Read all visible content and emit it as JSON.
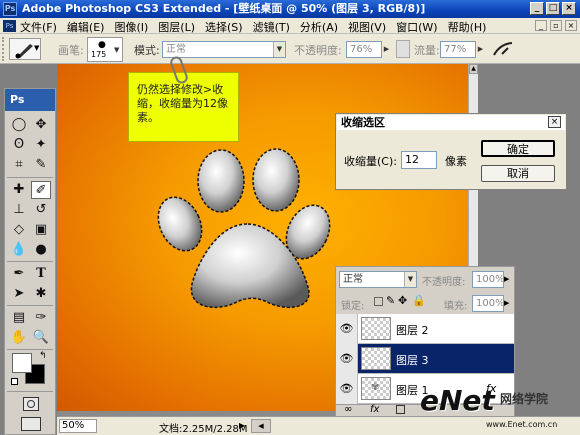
{
  "app": {
    "title": "Adobe Photoshop CS3 Extended - [壁纸桌面 @ 50% (图层 3, RGB/8)]",
    "icon_text": "Ps"
  },
  "menu": [
    "文件(F)",
    "编辑(E)",
    "图像(I)",
    "图层(L)",
    "选择(S)",
    "滤镜(T)",
    "分析(A)",
    "视图(V)",
    "窗口(W)",
    "帮助(H)"
  ],
  "options": {
    "brush_label": "画笔:",
    "brush_size": "175",
    "mode_label": "模式:",
    "mode_value": "正常",
    "opacity_label": "不透明度:",
    "opacity_value": "76%",
    "flow_label": "流量:",
    "flow_value": "77%"
  },
  "tools": {
    "header": "Ps"
  },
  "note": {
    "text": "仍然选择修改>收缩，收缩量为12像素。"
  },
  "dialog": {
    "title": "收缩选区",
    "amount_label": "收缩量(C):",
    "amount_value": "12",
    "unit": "像素",
    "ok": "确定",
    "cancel": "取消"
  },
  "layers": {
    "blend_mode": "正常",
    "opacity_label": "不透明度:",
    "opacity_value": "100%",
    "lock_label": "锁定:",
    "fill_label": "填充:",
    "fill_value": "100%",
    "items": [
      {
        "name": "图层 2",
        "selected": false
      },
      {
        "name": "图层 3",
        "selected": true
      },
      {
        "name": "图层 1",
        "selected": false
      }
    ],
    "fx": "fx"
  },
  "status": {
    "zoom": "50%",
    "doc": "文档:2.25M/2.28M"
  },
  "watermark": {
    "brand": "eNet",
    "cn": "网络学院",
    "url": "www.Enet.com.cn"
  }
}
